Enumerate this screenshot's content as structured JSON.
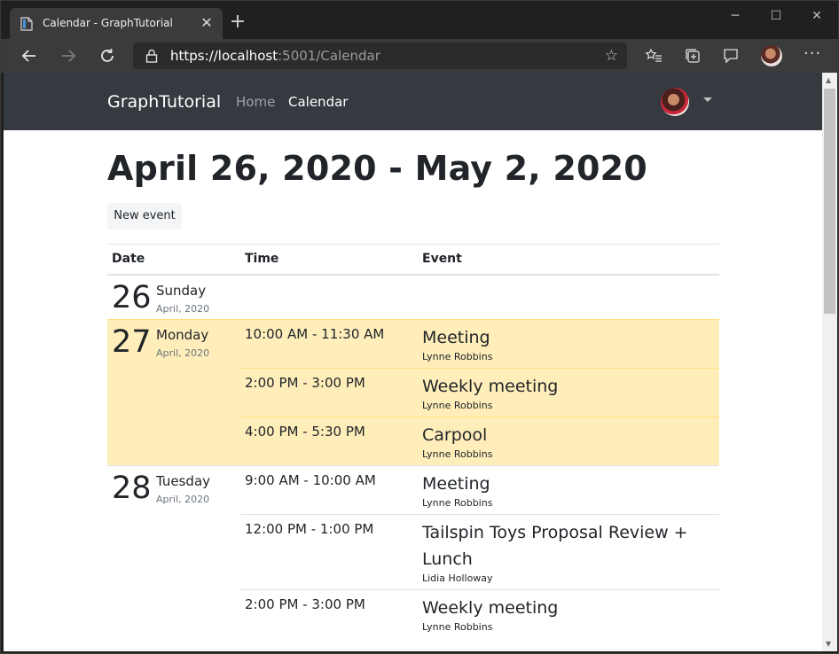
{
  "browser": {
    "tab_title": "Calendar - GraphTutorial",
    "url_scheme": "https://",
    "url_host": "localhost",
    "url_rest": ":5001/Calendar"
  },
  "app": {
    "brand": "GraphTutorial",
    "nav": [
      {
        "label": "Home",
        "color": "#a0a3a7"
      },
      {
        "label": "Calendar",
        "color": "#ffffff"
      }
    ],
    "heading": "April 26, 2020 - May 2, 2020",
    "new_event_label": "New event"
  },
  "table": {
    "headers": [
      "Date",
      "Time",
      "Event"
    ],
    "days": [
      {
        "num": "26",
        "name": "Sunday",
        "month": "April, 2020",
        "today": false,
        "events": []
      },
      {
        "num": "27",
        "name": "Monday",
        "month": "April, 2020",
        "today": true,
        "events": [
          {
            "time": "10:00 AM - 11:30 AM",
            "title": "Meeting",
            "organizer": "Lynne Robbins"
          },
          {
            "time": "2:00 PM - 3:00 PM",
            "title": "Weekly meeting",
            "organizer": "Lynne Robbins"
          },
          {
            "time": "4:00 PM - 5:30 PM",
            "title": "Carpool",
            "organizer": "Lynne Robbins"
          }
        ]
      },
      {
        "num": "28",
        "name": "Tuesday",
        "month": "April, 2020",
        "today": false,
        "events": [
          {
            "time": "9:00 AM - 10:00 AM",
            "title": "Meeting",
            "organizer": "Lynne Robbins"
          },
          {
            "time": "12:00 PM - 1:00 PM",
            "title": "Tailspin Toys Proposal Review + Lunch",
            "organizer": "Lidia Holloway"
          },
          {
            "time": "2:00 PM - 3:00 PM",
            "title": "Weekly meeting",
            "organizer": "Lynne Robbins"
          }
        ]
      }
    ]
  }
}
